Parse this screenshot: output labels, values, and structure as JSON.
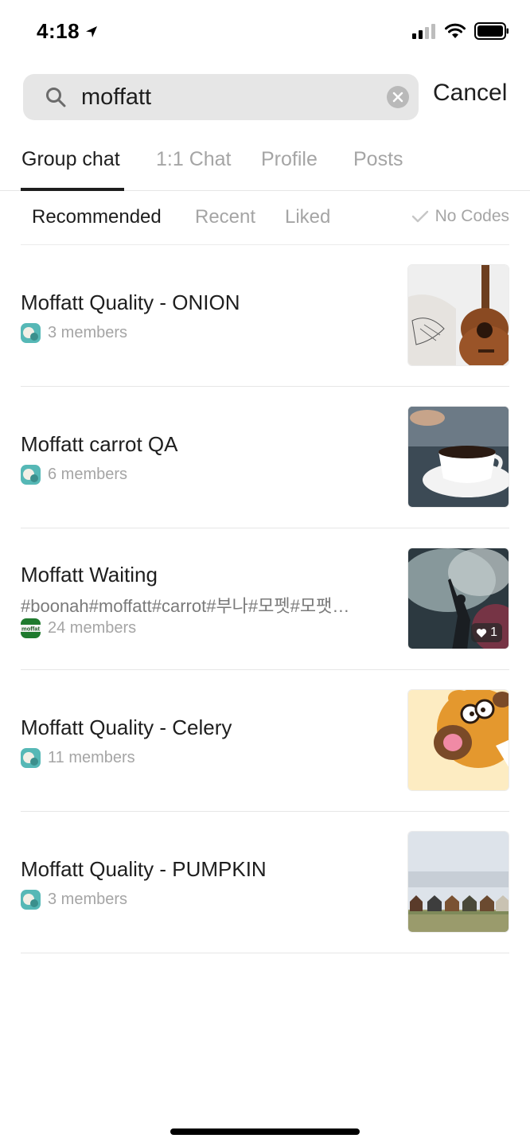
{
  "status_bar": {
    "time": "4:18"
  },
  "search": {
    "query": "moffatt",
    "cancel_label": "Cancel"
  },
  "tabs": [
    {
      "label": "Group chat",
      "active": true
    },
    {
      "label": "1:1 Chat",
      "active": false
    },
    {
      "label": "Profile",
      "active": false
    },
    {
      "label": "Posts",
      "active": false
    }
  ],
  "filters": {
    "options": [
      {
        "label": "Recommended",
        "active": true
      },
      {
        "label": "Recent",
        "active": false
      },
      {
        "label": "Liked",
        "active": false
      }
    ],
    "no_codes_label": "No Codes"
  },
  "results": [
    {
      "title": "Moffatt Quality - ONION",
      "tags": "",
      "members": "3 members",
      "thumbnail": "guitar",
      "likes": ""
    },
    {
      "title": "Moffatt carrot QA",
      "tags": "",
      "members": "6 members",
      "thumbnail": "coffee-cup",
      "likes": ""
    },
    {
      "title": "Moffatt Waiting",
      "tags": "#boonah#moffatt#carrot#부나#모펫#모팻…",
      "members": "24 members",
      "thumbnail": "concert-smoke",
      "likes": "1"
    },
    {
      "title": "Moffatt Quality - Celery",
      "tags": "",
      "members": "11 members",
      "thumbnail": "cartoon-lion",
      "likes": ""
    },
    {
      "title": "Moffatt Quality - PUMPKIN",
      "tags": "",
      "members": "3 members",
      "thumbnail": "beach-huts",
      "likes": ""
    }
  ],
  "avatar_logo_text": "moffat"
}
